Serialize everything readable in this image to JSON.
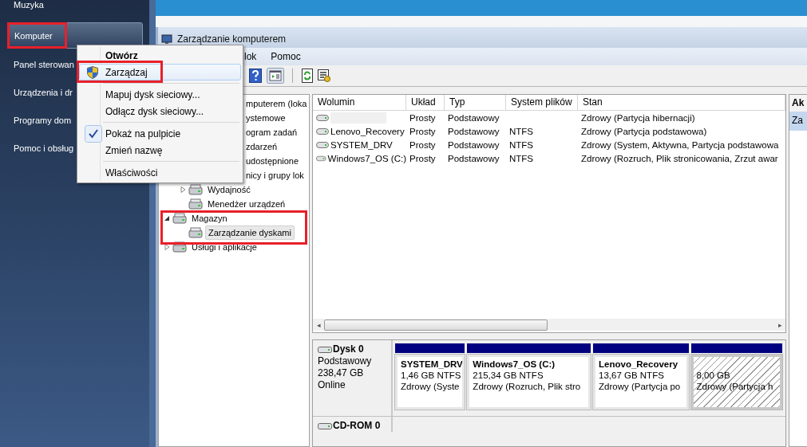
{
  "start_menu": {
    "items": [
      {
        "label": "Muzyka",
        "selected": false
      },
      {
        "label": "Komputer",
        "selected": true
      },
      {
        "label": "Panel sterowan",
        "selected": false
      },
      {
        "label": "Urządzenia i dr",
        "selected": false
      },
      {
        "label": "Programy dom",
        "selected": false
      },
      {
        "label": "Pomoc i obsług",
        "selected": false
      }
    ]
  },
  "context_menu": {
    "items": [
      {
        "kind": "default",
        "label": "Otwórz",
        "selected": false,
        "checked": false
      },
      {
        "kind": "admin",
        "label": "Zarządzaj",
        "selected": true,
        "checked": false
      },
      {
        "kind": "separator"
      },
      {
        "kind": "item",
        "label": "Mapuj dysk sieciowy...",
        "selected": false,
        "checked": false
      },
      {
        "kind": "item",
        "label": "Odłącz dysk sieciowy...",
        "selected": false,
        "checked": false
      },
      {
        "kind": "separator"
      },
      {
        "kind": "item",
        "label": "Pokaż na pulpicie",
        "selected": false,
        "checked": true
      },
      {
        "kind": "item",
        "label": "Zmień nazwę",
        "selected": false,
        "checked": false
      },
      {
        "kind": "separator"
      },
      {
        "kind": "item",
        "label": "Właściwości",
        "selected": false,
        "checked": false
      }
    ]
  },
  "window": {
    "title": "Zarządzanie komputerem",
    "menu_bar": [
      "lok",
      "Pomoc"
    ]
  },
  "tree": {
    "items": [
      {
        "label": "mputerem (loka",
        "selected": false,
        "obscured": true,
        "children": [
          {
            "label": "ystemowe",
            "selected": false,
            "obscured": true,
            "children": [
              {
                "label": "ogram zadań",
                "selected": false,
                "obscured": true
              },
              {
                "label": "zdarzeń",
                "selected": false,
                "obscured": true
              },
              {
                "label": "udostępnione",
                "selected": false,
                "obscured": true
              },
              {
                "label": "nicy i grupy lok",
                "selected": false,
                "obscured": true
              },
              {
                "label": "Wydajność",
                "selected": false,
                "expanded": false
              },
              {
                "label": "Menedżer urządzeń",
                "selected": false
              }
            ]
          },
          {
            "label": "Magazyn",
            "selected": false,
            "expanded": true,
            "children": [
              {
                "label": "Zarządzanie dyskami",
                "selected": true
              }
            ]
          },
          {
            "label": "Usługi i aplikacje",
            "selected": false,
            "expanded": false
          }
        ]
      }
    ]
  },
  "volumes": {
    "columns": [
      "Wolumin",
      "Układ",
      "Typ",
      "System plików",
      "Stan"
    ],
    "rows": [
      {
        "redacted": true,
        "layout": "Prosty",
        "type": "Podstawowy",
        "status": "Zdrowy (Partycja hibernacji)"
      },
      {
        "name": "Lenovo_Recovery",
        "redacted": false,
        "layout": "Prosty",
        "type": "Podstawowy",
        "fs": "NTFS",
        "status": "Zdrowy (Partycja podstawowa)"
      },
      {
        "name": "SYSTEM_DRV",
        "redacted": false,
        "layout": "Prosty",
        "type": "Podstawowy",
        "fs": "NTFS",
        "status": "Zdrowy (System, Aktywna, Partycja podstawowa"
      },
      {
        "name": "Windows7_OS (C:)",
        "redacted": false,
        "layout": "Prosty",
        "type": "Podstawowy",
        "fs": "NTFS",
        "status": "Zdrowy (Rozruch, Plik stronicowania, Zrzut awar"
      }
    ]
  },
  "disks": [
    {
      "name": "Dysk 0",
      "details": [
        "Podstawowy",
        "238,47 GB",
        "Online"
      ],
      "partitions": [
        {
          "name": "SYSTEM_DRV",
          "size": "1,46 GB NTFS",
          "status": "Zdrowy (Syste",
          "selected": false
        },
        {
          "name": "Windows7_OS  (C:)",
          "size": "215,34 GB NTFS",
          "status": "Zdrowy (Rozruch, Plik stro",
          "selected": false
        },
        {
          "name": "Lenovo_Recovery",
          "size": "13,67 GB NTFS",
          "status": "Zdrowy (Partycja po",
          "selected": false
        },
        {
          "size": "8,00 GB",
          "status": "Zdrowy (Partycja h",
          "selected": true
        }
      ]
    },
    {
      "name": "CD-ROM 0"
    }
  ],
  "scrollbar": {
    "left": "◂",
    "right": "▸"
  },
  "actions": {
    "header": "Ak",
    "items": [
      {
        "label": "Za",
        "selected": true
      }
    ]
  }
}
